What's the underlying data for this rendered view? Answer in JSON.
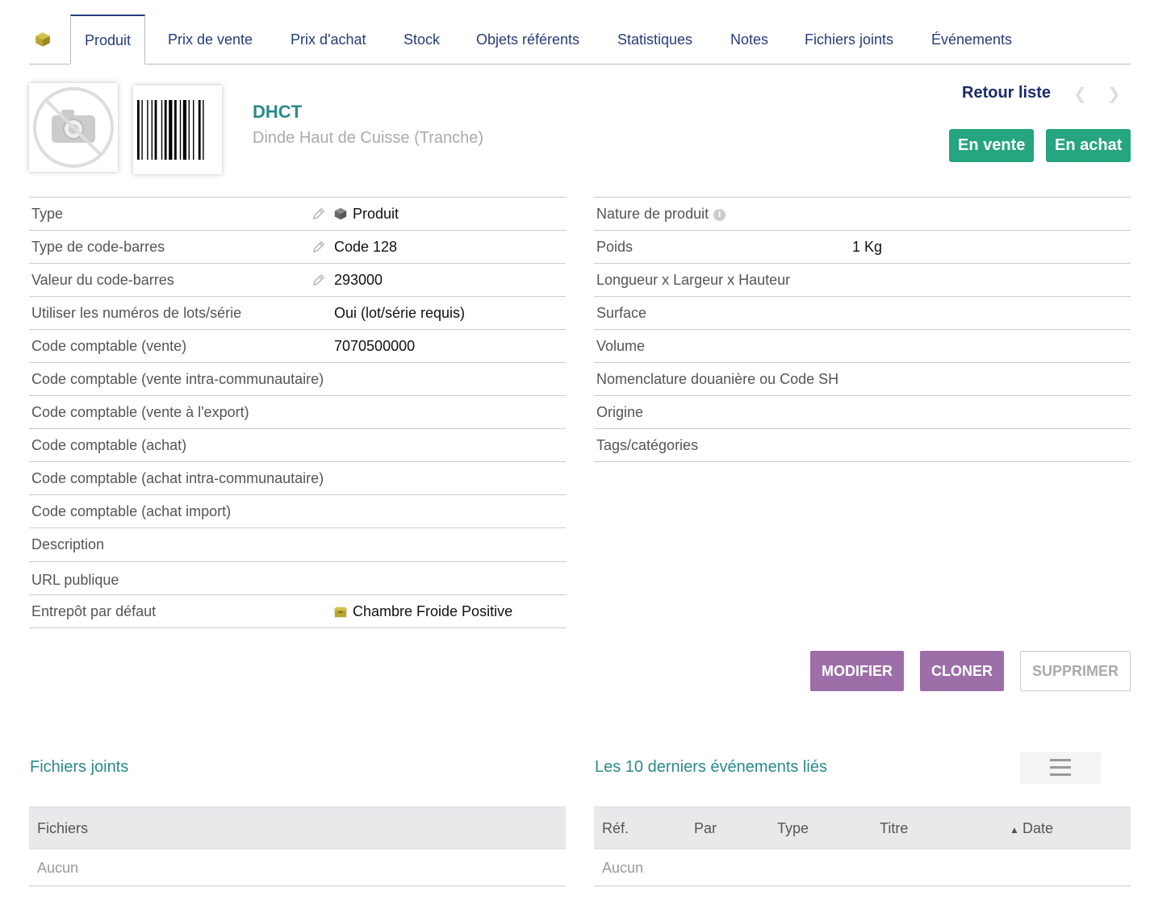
{
  "tabs": [
    {
      "label": "Produit",
      "active": true
    },
    {
      "label": "Prix de vente"
    },
    {
      "label": "Prix d'achat"
    },
    {
      "label": "Stock"
    },
    {
      "label": "Objets référents"
    },
    {
      "label": "Statistiques"
    },
    {
      "label": "Notes"
    },
    {
      "label": "Fichiers joints"
    },
    {
      "label": "Événements"
    }
  ],
  "header": {
    "ref": "DHCT",
    "label": "Dinde Haut de Cuisse (Tranche)",
    "back_link": "Retour liste",
    "prev_icon": "chevron-left-icon",
    "next_icon": "chevron-right-icon",
    "badges": [
      "En vente",
      "En achat"
    ]
  },
  "left_fields": [
    {
      "label": "Type",
      "value": "Produit",
      "editable": true,
      "icon": "product-box-icon"
    },
    {
      "label": "Type de code-barres",
      "value": "Code 128",
      "editable": true
    },
    {
      "label": "Valeur du code-barres",
      "value": "293000",
      "editable": true
    },
    {
      "label": "Utiliser les numéros de lots/série",
      "value": "Oui (lot/série requis)"
    },
    {
      "label": "Code comptable (vente)",
      "value": "7070500000"
    },
    {
      "label": "Code comptable (vente intra-communautaire)",
      "value": ""
    },
    {
      "label": "Code comptable (vente à l'export)",
      "value": ""
    },
    {
      "label": "Code comptable (achat)",
      "value": ""
    },
    {
      "label": "Code comptable (achat intra-communautaire)",
      "value": ""
    },
    {
      "label": "Code comptable (achat import)",
      "value": ""
    },
    {
      "label": "Description",
      "value": ""
    },
    {
      "label": "URL publique",
      "value": ""
    },
    {
      "label": "Entrepôt par défaut",
      "value": "Chambre Froide Positive",
      "icon": "warehouse-icon",
      "link": true
    }
  ],
  "right_fields": [
    {
      "label": "Nature de produit",
      "value": "",
      "info": true
    },
    {
      "label": "Poids",
      "value": "1 Kg"
    },
    {
      "label": "Longueur x Largeur x Hauteur",
      "value": ""
    },
    {
      "label": "Surface",
      "value": ""
    },
    {
      "label": "Volume",
      "value": ""
    },
    {
      "label": "Nomenclature douanière ou Code SH",
      "value": ""
    },
    {
      "label": "Origine",
      "value": ""
    },
    {
      "label": "Tags/catégories",
      "value": ""
    }
  ],
  "actions": {
    "modify": "MODIFIER",
    "clone": "CLONER",
    "delete": "SUPPRIMER"
  },
  "files_section": {
    "title": "Fichiers joints",
    "column": "Fichiers",
    "empty": "Aucun"
  },
  "events_section": {
    "title": "Les 10 derniers événements liés",
    "columns": [
      "Réf.",
      "Par",
      "Type",
      "Titre",
      "Date"
    ],
    "sort_icon": "sort-asc-icon",
    "empty": "Aucun"
  },
  "colors": {
    "accent_teal": "#2a8a8a",
    "badge_green": "#25a580",
    "button_purple": "#9d6ea8",
    "link_navy": "#1a2a6a"
  }
}
